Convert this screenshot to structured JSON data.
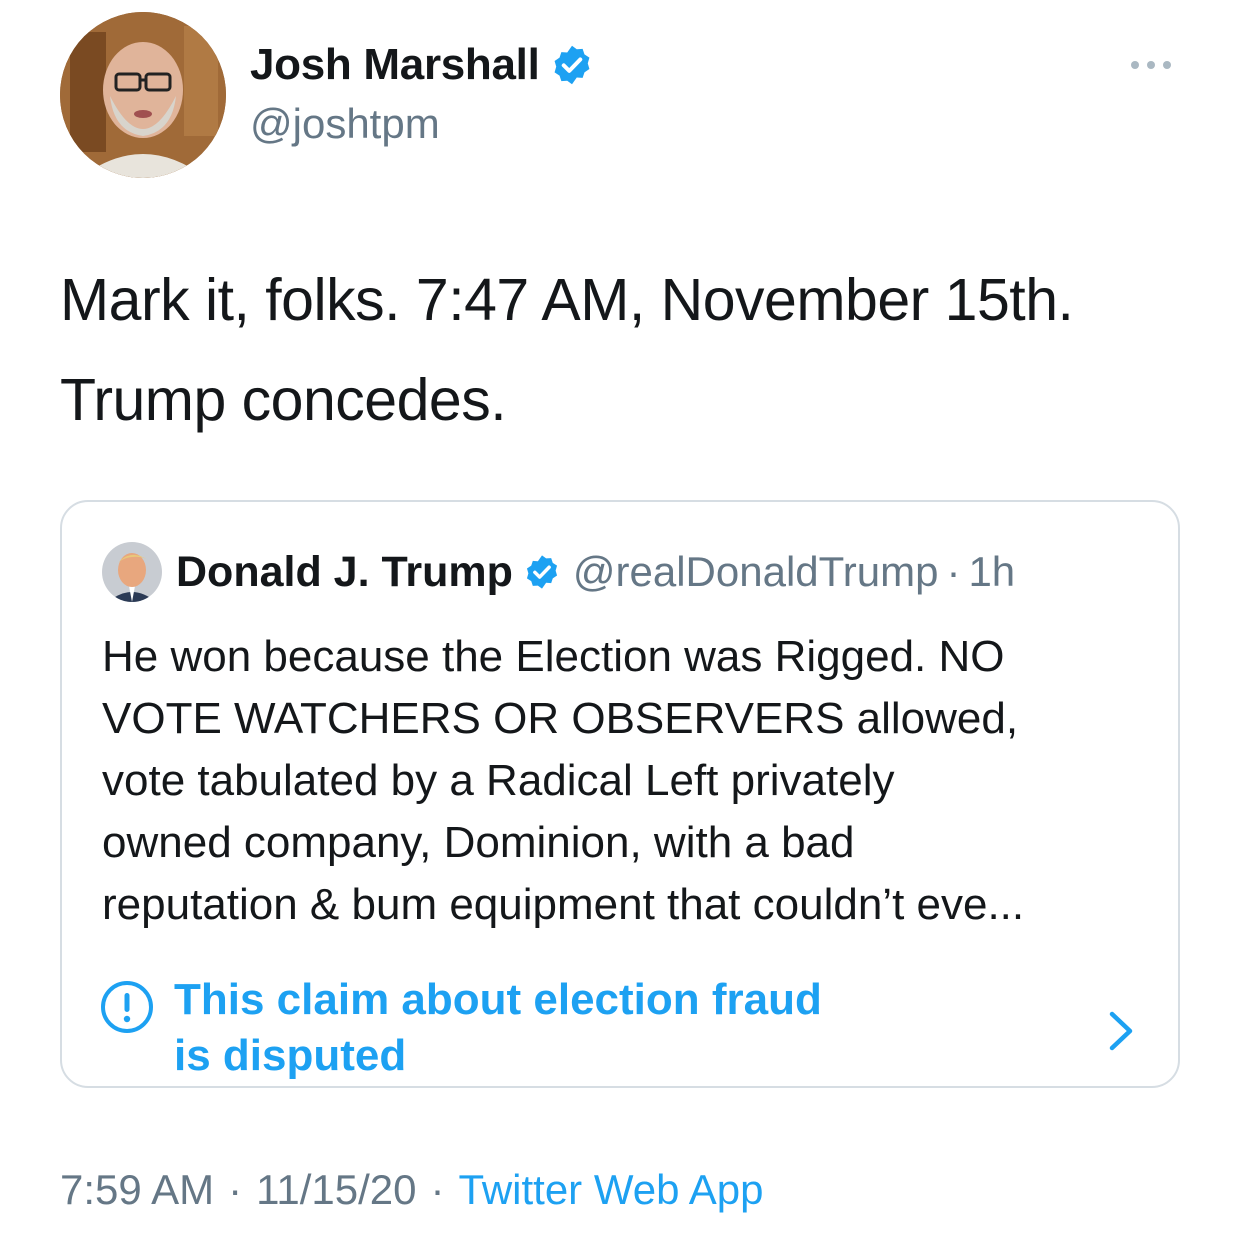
{
  "tweet": {
    "author_name": "Josh Marshall",
    "author_handle": "@joshtpm",
    "text_line1": "Mark it, folks. 7:47 AM, November 15th.",
    "text_line2": "Trump concedes.",
    "time": "7:59 AM",
    "date": "11/15/20",
    "source": "Twitter Web App",
    "separator": "·"
  },
  "quoted": {
    "author_name": "Donald J. Trump",
    "author_handle": "@realDonaldTrump",
    "separator": "·",
    "age": "1h",
    "lines": [
      "He won because the Election was Rigged. NO",
      "VOTE WATCHERS OR OBSERVERS allowed,",
      "vote tabulated by a Radical Left privately",
      "owned company, Dominion, with a bad",
      "reputation & bum equipment that couldn’t eve..."
    ],
    "label_line1": "This claim about election fraud",
    "label_line2": "is disputed"
  },
  "colors": {
    "link_blue": "#1da1f2",
    "secondary_gray": "#657786",
    "text_black": "#14171a",
    "border": "#d6dde3"
  },
  "icons": {
    "verified": "verified-badge-icon",
    "more": "more-options-icon",
    "warning": "exclamation-circle-icon",
    "chevron": "chevron-right-icon"
  }
}
